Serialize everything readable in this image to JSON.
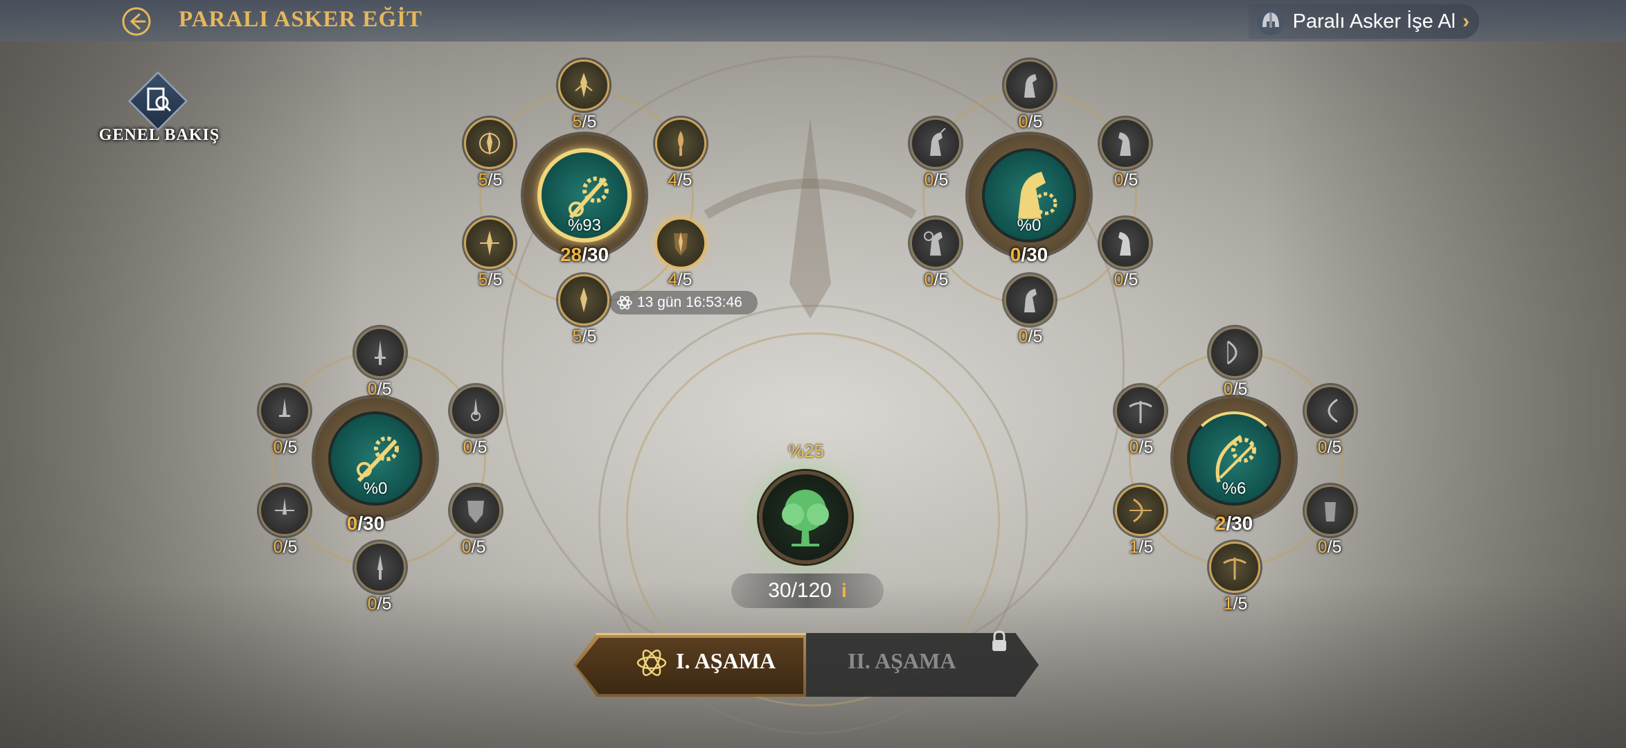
{
  "header": {
    "title": "PARALI ASKER EĞİT",
    "hire_label": "Paralı Asker İşe Al",
    "hire_chevron": "›"
  },
  "overview": {
    "label": "GENEL BAKIŞ"
  },
  "groups": {
    "spear": {
      "center_pct": "%93",
      "level_done": "28",
      "level_max": "/30",
      "nodes": [
        {
          "done": "5",
          "max": "/5"
        },
        {
          "done": "5",
          "max": "/5"
        },
        {
          "done": "4",
          "max": "/5"
        },
        {
          "done": "5",
          "max": "/5"
        },
        {
          "done": "4",
          "max": "/5"
        },
        {
          "done": "5",
          "max": "/5"
        }
      ],
      "timer": "13 gün 16:53:46"
    },
    "cavalry": {
      "center_pct": "%0",
      "level_done": "0",
      "level_max": "/30",
      "nodes": [
        {
          "done": "0",
          "max": "/5"
        },
        {
          "done": "0",
          "max": "/5"
        },
        {
          "done": "0",
          "max": "/5"
        },
        {
          "done": "0",
          "max": "/5"
        },
        {
          "done": "0",
          "max": "/5"
        },
        {
          "done": "0",
          "max": "/5"
        }
      ]
    },
    "sword": {
      "center_pct": "%0",
      "level_done": "0",
      "level_max": "/30",
      "nodes": [
        {
          "done": "0",
          "max": "/5"
        },
        {
          "done": "0",
          "max": "/5"
        },
        {
          "done": "0",
          "max": "/5"
        },
        {
          "done": "0",
          "max": "/5"
        },
        {
          "done": "0",
          "max": "/5"
        },
        {
          "done": "0",
          "max": "/5"
        }
      ]
    },
    "archer": {
      "center_pct": "%6",
      "level_done": "2",
      "level_max": "/30",
      "nodes": [
        {
          "done": "0",
          "max": "/5"
        },
        {
          "done": "0",
          "max": "/5"
        },
        {
          "done": "0",
          "max": "/5"
        },
        {
          "done": "1",
          "max": "/5"
        },
        {
          "done": "0",
          "max": "/5"
        },
        {
          "done": "1",
          "max": "/5"
        }
      ]
    }
  },
  "tree": {
    "pct": "%25",
    "level": "30/120",
    "info": "i"
  },
  "stages": {
    "stage1": "I. AŞAMA",
    "stage2": "II. AŞAMA"
  },
  "colors": {
    "accent": "#f2b544",
    "title": "#e6b85c",
    "teal": "#10504b"
  }
}
